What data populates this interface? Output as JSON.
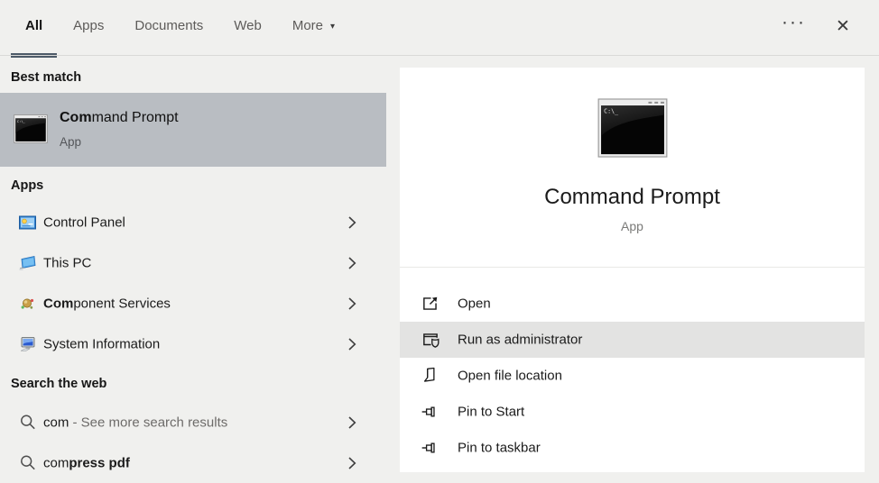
{
  "tabs": [
    {
      "label": "All",
      "active": true
    },
    {
      "label": "Apps",
      "active": false
    },
    {
      "label": "Documents",
      "active": false
    },
    {
      "label": "Web",
      "active": false
    },
    {
      "label": "More",
      "active": false,
      "has_dropdown": true
    }
  ],
  "glyphs": {
    "dropdown": "▾",
    "more_options": "···",
    "close": "✕"
  },
  "left": {
    "best_match": {
      "header": "Best match",
      "item": {
        "icon": "command-prompt-icon",
        "title_bold": "Com",
        "title_rest": "mand Prompt",
        "subtitle": "App"
      }
    },
    "apps": {
      "header": "Apps",
      "items": [
        {
          "icon": "control-panel-icon",
          "label_bold": "",
          "label_rest": "Control Panel"
        },
        {
          "icon": "this-pc-icon",
          "label_bold": "",
          "label_rest": "This PC"
        },
        {
          "icon": "component-services-icon",
          "label_bold": "Com",
          "label_rest": "ponent Services"
        },
        {
          "icon": "system-information-icon",
          "label_bold": "",
          "label_rest": "System Information"
        }
      ]
    },
    "search_web": {
      "header": "Search the web",
      "items": [
        {
          "icon": "search-icon",
          "query": "com",
          "suffix_gray": "- See more search results"
        },
        {
          "icon": "search-icon",
          "query": "com",
          "suffix_bold": "press pdf"
        }
      ]
    }
  },
  "preview": {
    "icon": "command-prompt-icon",
    "title": "Command Prompt",
    "subtitle": "App"
  },
  "actions": [
    {
      "icon": "open-icon",
      "label": "Open",
      "highlighted": false
    },
    {
      "icon": "run-as-administrator-icon",
      "label": "Run as administrator",
      "highlighted": true
    },
    {
      "icon": "open-file-location-icon",
      "label": "Open file location",
      "highlighted": false
    },
    {
      "icon": "pin-to-start-icon",
      "label": "Pin to Start",
      "highlighted": false
    },
    {
      "icon": "pin-to-taskbar-icon",
      "label": "Pin to taskbar",
      "highlighted": false
    }
  ],
  "colors": {
    "app_background": "#f0f0ee",
    "tab_indicator": "#4d5a68",
    "best_match_highlight": "#b9bdc2",
    "action_highlight": "#e3e3e2",
    "panel_background": "#ffffff"
  }
}
